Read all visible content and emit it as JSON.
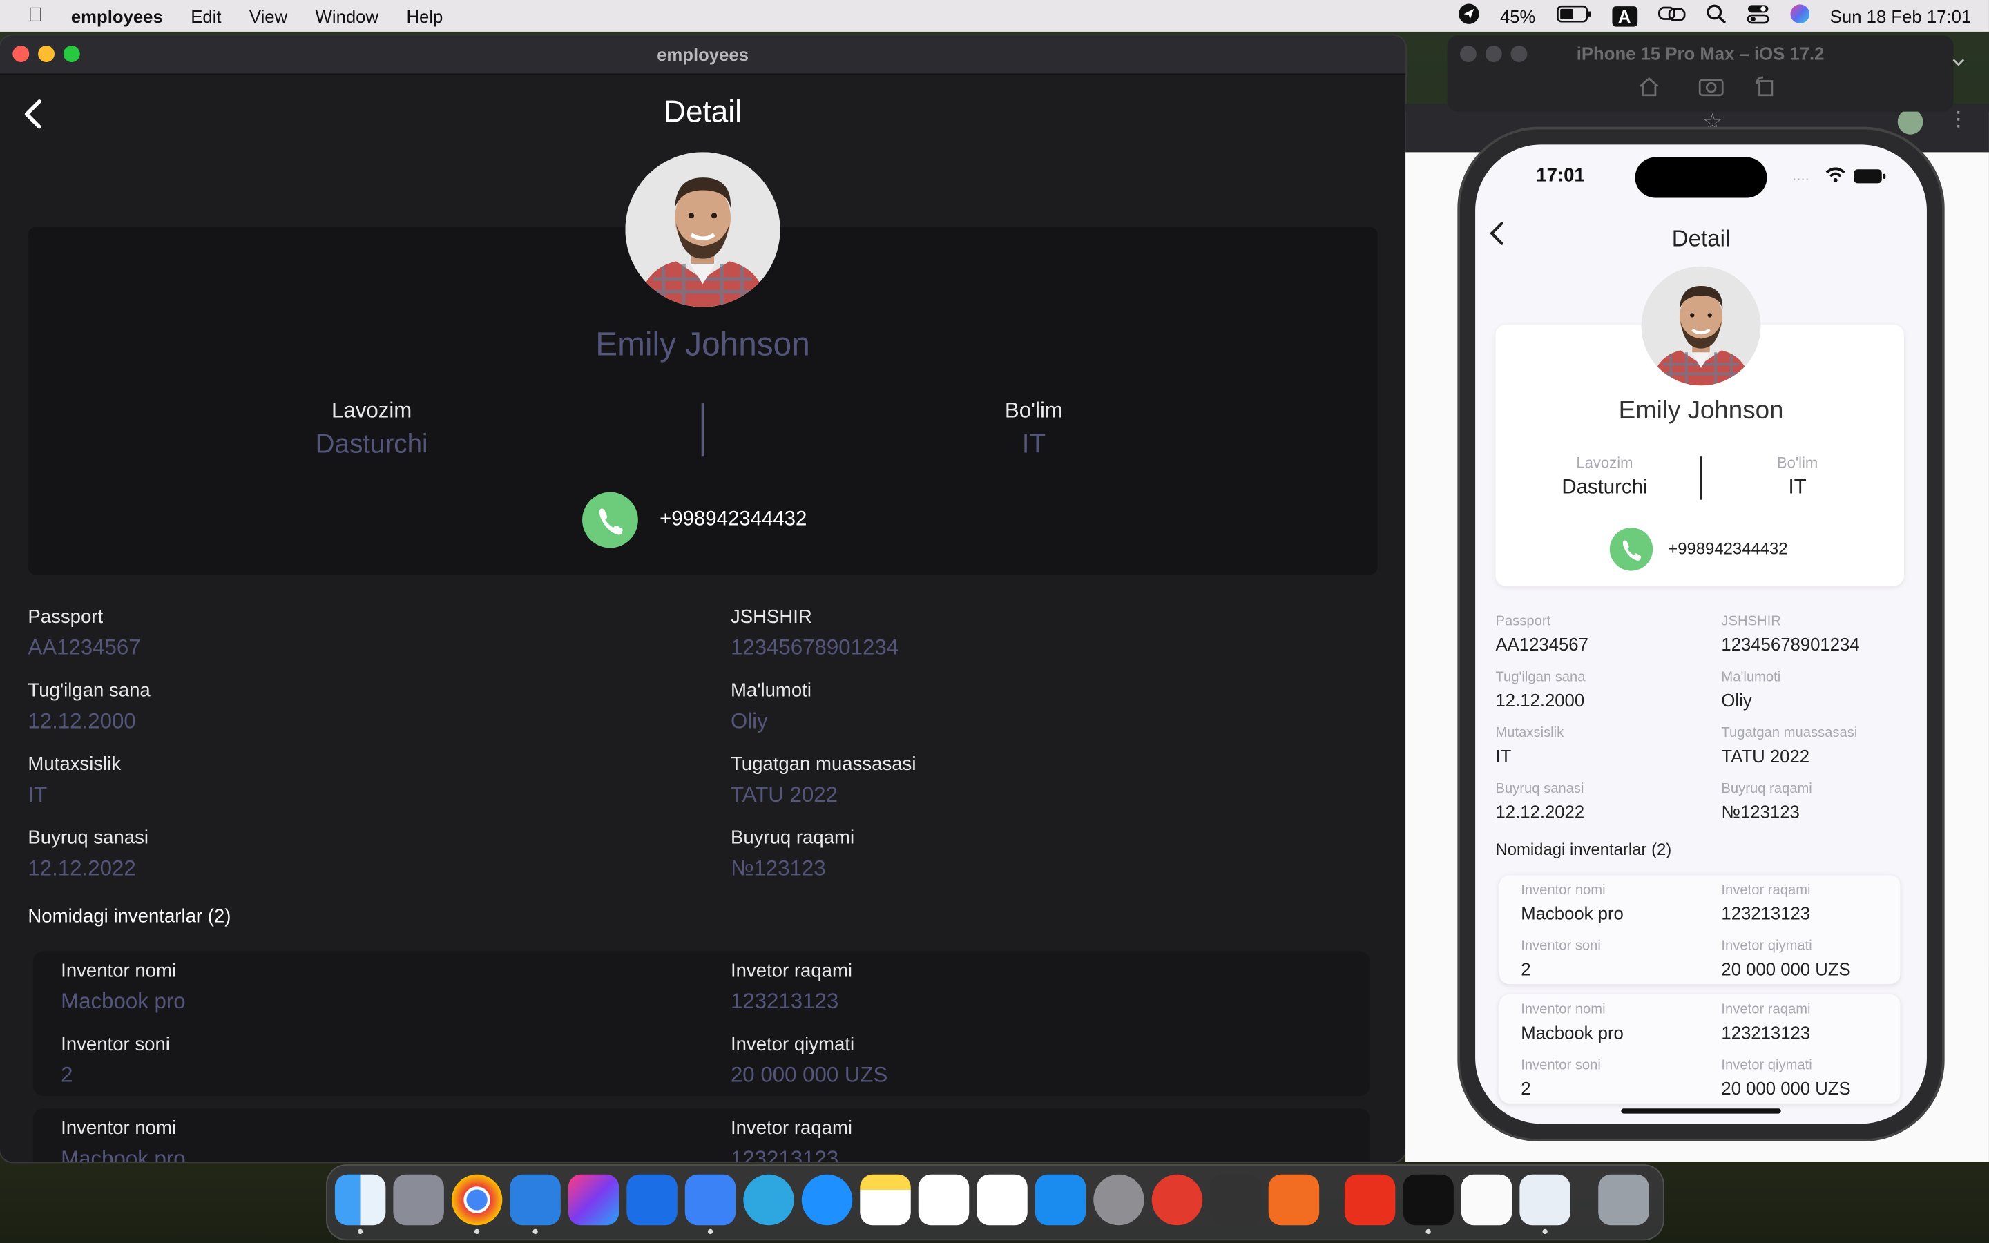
{
  "menubar": {
    "app": "employees",
    "items": [
      "Edit",
      "View",
      "Window",
      "Help"
    ],
    "battery": "45%",
    "input": "A",
    "datetime": "Sun 18 Feb  17:01"
  },
  "window": {
    "title": "employees"
  },
  "detail": {
    "title": "Detail",
    "name": "Emily Johnson",
    "position_label": "Lavozim",
    "position": "Dasturchi",
    "dept_label": "Bo'lim",
    "dept": "IT",
    "phone": "+998942344432"
  },
  "fields": [
    {
      "label": "Passport",
      "value": "AA1234567"
    },
    {
      "label": "JSHSHIR",
      "value": "12345678901234"
    },
    {
      "label": "Tug'ilgan sana",
      "value": "12.12.2000"
    },
    {
      "label": "Ma'lumoti",
      "value": "Oliy"
    },
    {
      "label": "Mutaxsislik",
      "value": "IT"
    },
    {
      "label": "Tugatgan muassasasi",
      "value": "TATU 2022"
    },
    {
      "label": "Buyruq sanasi",
      "value": "12.12.2022"
    },
    {
      "label": "Buyruq raqami",
      "value": "№123123"
    }
  ],
  "inventory": {
    "title": "Nomidagi inventarlar (2)",
    "items": [
      {
        "name_label": "Inventor nomi",
        "name": "Macbook pro",
        "num_label": "Invetor raqami",
        "num": "123213123",
        "count_label": "Inventor soni",
        "count": "2",
        "price_label": "Invetor qiymati",
        "price": "20 000 000 UZS"
      },
      {
        "name_label": "Inventor nomi",
        "name": "Macbook pro",
        "num_label": "Invetor raqami",
        "num": "123213123",
        "count_label": "Inventor soni",
        "count": "2",
        "price_label": "Invetor qiymati",
        "price": "20 000 000 UZS"
      }
    ]
  },
  "simulator": {
    "title": "iPhone 15 Pro Max – iOS 17.2",
    "time": "17:01"
  },
  "colors": {
    "accent": "#53557a",
    "call": "#6ccc7c",
    "dark_bg": "#1c1c1f"
  }
}
